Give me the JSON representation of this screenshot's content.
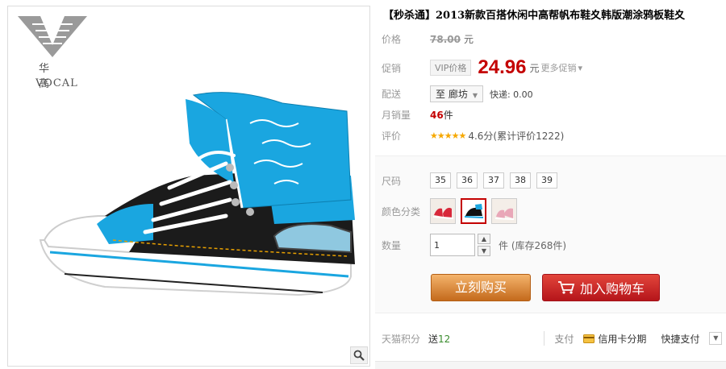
{
  "brand": {
    "name": "华 高",
    "latin": "VOCAL"
  },
  "product": {
    "title": "【秒杀通】2013新款百搭休闲中高帮帆布鞋夊韩版潮涂鸦板鞋夊"
  },
  "price": {
    "label": "价格",
    "original": "78.00",
    "currency": "元"
  },
  "promo": {
    "label": "促销",
    "badge": "VIP价格",
    "price": "24.96",
    "currency": "元",
    "more": "更多促销",
    "more_arrow": "▾"
  },
  "shipping": {
    "label": "配送",
    "location": "至 廊坊",
    "location_arrow": "▼",
    "express": "快递: 0.00"
  },
  "sales": {
    "label": "月销量",
    "count": "46",
    "unit": "件"
  },
  "review": {
    "label": "评价",
    "stars": "★★★★★",
    "text": "4.6分(累计评价1222)"
  },
  "size": {
    "label": "尺码",
    "options": [
      "35",
      "36",
      "37",
      "38",
      "39"
    ]
  },
  "color": {
    "label": "颜色分类",
    "selected_index": 1
  },
  "quantity": {
    "label": "数量",
    "value": "1",
    "up": "▲",
    "down": "▼",
    "stock": "件 (库存268件)"
  },
  "actions": {
    "buy": "立刻购买",
    "cart": "加入购物车"
  },
  "footer": {
    "points_label": "天猫积分",
    "points_prefix": "送",
    "points_value": "12",
    "pay_label": "支付",
    "credit": "信用卡分期",
    "fast_pay": "快捷支付",
    "dropdown": "▼"
  },
  "colors": {
    "price_red": "#c40000",
    "buy_orange": "#d9822b",
    "cart_red": "#c8201f",
    "shoe_blue": "#1aa6e0"
  }
}
